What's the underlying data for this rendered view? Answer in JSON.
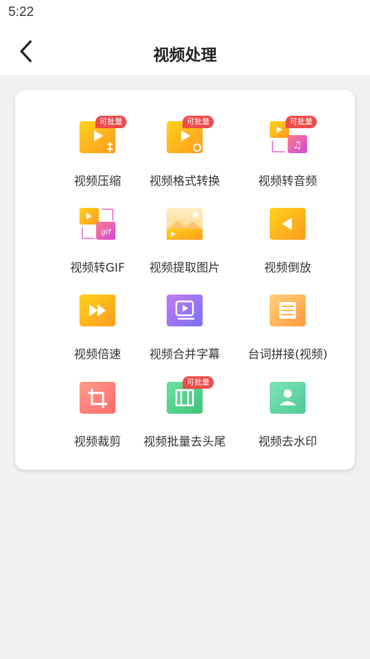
{
  "status_bar": {
    "time": "5:22"
  },
  "header": {
    "title": "视频处理"
  },
  "badge_text": "可批量",
  "tools": [
    {
      "label": "视频压缩",
      "icon": "video-compress-icon",
      "batch": true
    },
    {
      "label": "视频格式转换",
      "icon": "video-format-convert-icon",
      "batch": true
    },
    {
      "label": "视频转音频",
      "icon": "video-to-audio-icon",
      "batch": true
    },
    {
      "label": "视频转GIF",
      "icon": "video-to-gif-icon",
      "batch": false
    },
    {
      "label": "视频提取图片",
      "icon": "video-extract-image-icon",
      "batch": false
    },
    {
      "label": "视频倒放",
      "icon": "video-reverse-icon",
      "batch": false
    },
    {
      "label": "视频倍速",
      "icon": "video-speed-icon",
      "batch": false
    },
    {
      "label": "视频合并字幕",
      "icon": "video-merge-subtitle-icon",
      "batch": false
    },
    {
      "label": "台词拼接(视频)",
      "icon": "lines-stitch-icon",
      "batch": false
    },
    {
      "label": "视频裁剪",
      "icon": "video-crop-icon",
      "batch": false
    },
    {
      "label": "视频批量去头尾",
      "icon": "video-batch-trim-icon",
      "batch": true
    },
    {
      "label": "视频去水印",
      "icon": "video-remove-watermark-icon",
      "batch": false
    }
  ],
  "colors": {
    "accent_yellow": "#ffc21a",
    "accent_orange": "#ff9a1f",
    "badge_red": "#ee4b4b"
  }
}
